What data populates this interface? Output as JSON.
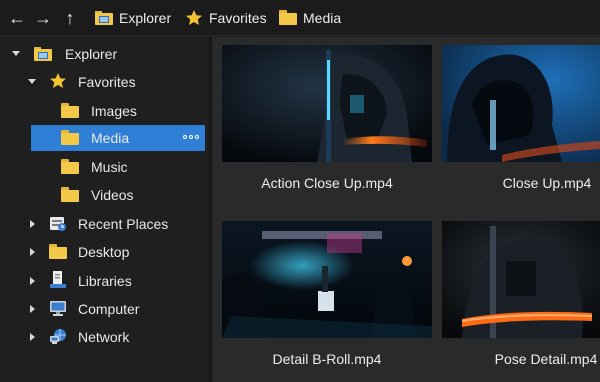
{
  "toolbar": {
    "back_icon": "arrow-left-icon",
    "forward_icon": "arrow-right-icon",
    "up_icon": "arrow-up-icon",
    "breadcrumb": [
      {
        "label": "Explorer",
        "icon": "explorer-icon"
      },
      {
        "label": "Favorites",
        "icon": "star-icon"
      },
      {
        "label": "Media",
        "icon": "folder-icon"
      }
    ]
  },
  "sidebar": {
    "items": [
      {
        "label": "Explorer",
        "icon": "explorer-icon",
        "expanded": true,
        "level": 0
      },
      {
        "label": "Favorites",
        "icon": "star-icon",
        "expanded": true,
        "level": 1
      },
      {
        "label": "Images",
        "icon": "folder-icon",
        "level": 2
      },
      {
        "label": "Media",
        "icon": "folder-icon",
        "level": 2,
        "selected": true
      },
      {
        "label": "Music",
        "icon": "folder-icon",
        "level": 2
      },
      {
        "label": "Videos",
        "icon": "folder-icon",
        "level": 2
      },
      {
        "label": "Recent Places",
        "icon": "recent-places-icon",
        "expanded": false,
        "level": 1
      },
      {
        "label": "Desktop",
        "icon": "folder-icon",
        "expanded": false,
        "level": 1
      },
      {
        "label": "Libraries",
        "icon": "libraries-icon",
        "expanded": false,
        "level": 1
      },
      {
        "label": "Computer",
        "icon": "computer-icon",
        "expanded": false,
        "level": 1
      },
      {
        "label": "Network",
        "icon": "network-icon",
        "expanded": false,
        "level": 1
      }
    ]
  },
  "files": [
    {
      "name": "Action Close Up.mp4"
    },
    {
      "name": "Close Up.mp4"
    },
    {
      "name": "Detail B-Roll.mp4"
    },
    {
      "name": "Pose Detail.mp4"
    }
  ],
  "colors": {
    "accent": "#2f7fd7",
    "folder": "#f3c94a",
    "star": "#f2c233",
    "background": "#1f1f1f",
    "content_bg": "#2a2a2a"
  }
}
